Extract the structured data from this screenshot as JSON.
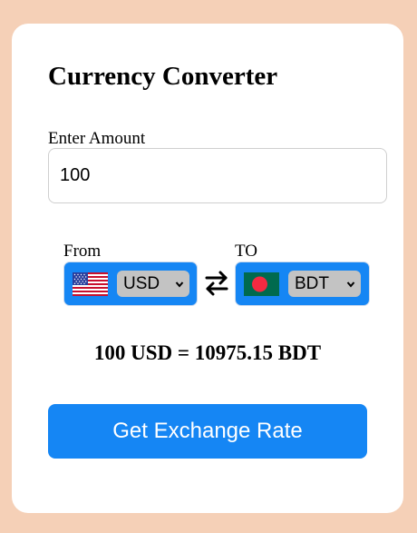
{
  "title": "Currency Converter",
  "amount": {
    "label": "Enter Amount",
    "value": "100"
  },
  "from": {
    "label": "From",
    "currency": "USD",
    "flag_icon": "us-flag-icon"
  },
  "to": {
    "label": "TO",
    "currency": "BDT",
    "flag_icon": "bd-flag-icon"
  },
  "swap_icon": "swap-arrows-icon",
  "result": "100 USD = 10975.15 BDT",
  "button": {
    "label": "Get Exchange Rate"
  },
  "colors": {
    "page_background": "#f5d0b7",
    "card_background": "#ffffff",
    "accent": "#1586f4",
    "select_background": "#c3c3c3"
  }
}
